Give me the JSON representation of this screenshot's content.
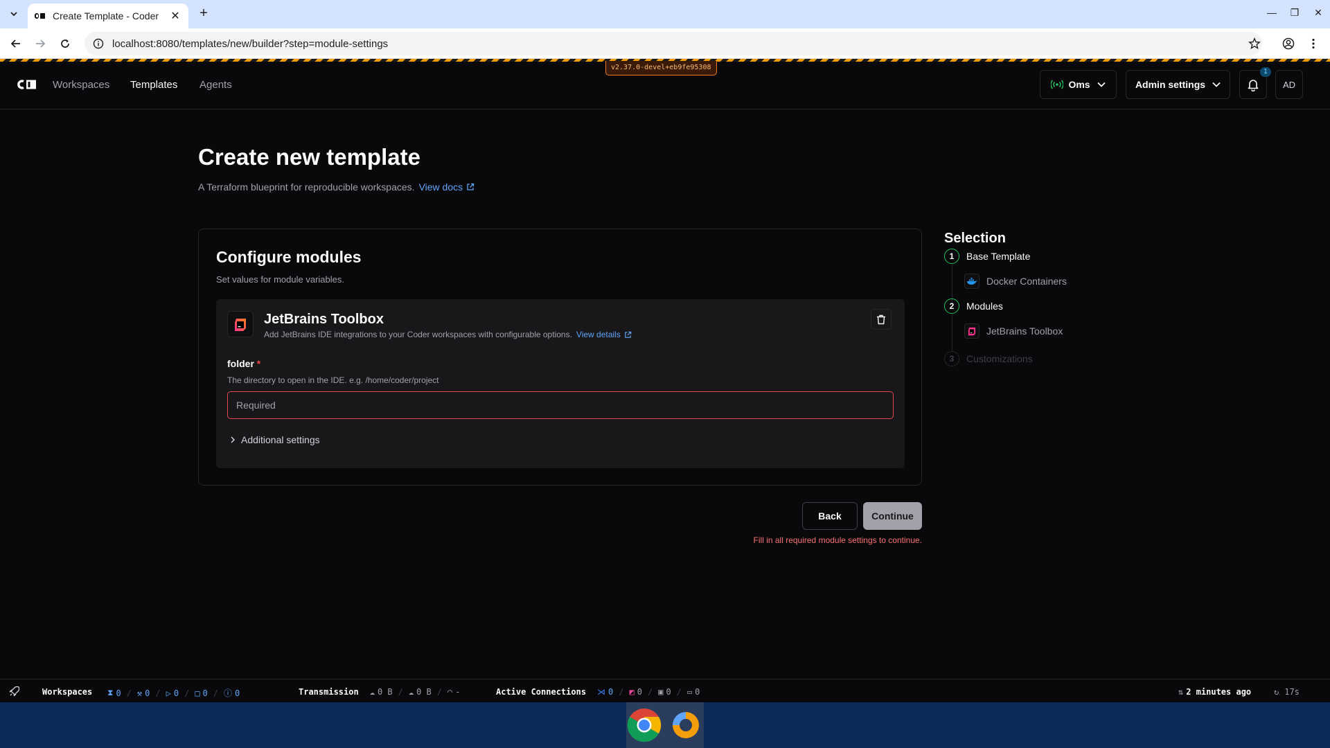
{
  "browser": {
    "tab_title": "Create Template - Coder",
    "url": "localhost:8080/templates/new/builder?step=module-settings"
  },
  "version_badge": "v2.37.0-devel+eb9fe95308",
  "nav": {
    "workspaces": "Workspaces",
    "templates": "Templates",
    "agents": "Agents",
    "region": "Oms",
    "admin_settings": "Admin settings",
    "notification_count": "1",
    "avatar": "AD"
  },
  "page": {
    "title": "Create new template",
    "subtitle": "A Terraform blueprint for reproducible workspaces.",
    "docs_link": "View docs"
  },
  "card": {
    "title": "Configure modules",
    "subtitle": "Set values for module variables.",
    "module": {
      "name": "JetBrains Toolbox",
      "description": "Add JetBrains IDE integrations to your Coder workspaces with configurable options.",
      "details_link": "View details",
      "field_label": "folder",
      "field_required_mark": "*",
      "field_help": "The directory to open in the IDE. e.g. /home/coder/project",
      "field_placeholder": "Required",
      "field_value": "",
      "additional_settings": "Additional settings"
    }
  },
  "actions": {
    "back": "Back",
    "continue": "Continue",
    "error": "Fill in all required module settings to continue."
  },
  "selection": {
    "title": "Selection",
    "steps": [
      {
        "num": "1",
        "label": "Base Template",
        "item": "Docker Containers",
        "state": "done"
      },
      {
        "num": "2",
        "label": "Modules",
        "item": "JetBrains Toolbox",
        "state": "done"
      },
      {
        "num": "3",
        "label": "Customizations",
        "state": "pending"
      }
    ]
  },
  "statusbar": {
    "workspaces_label": "Workspaces",
    "pending": "0",
    "building": "0",
    "running": "0",
    "stopped": "0",
    "failed": "0",
    "transmission_label": "Transmission",
    "tx_down": "0 B",
    "tx_up": "0 B",
    "latency": "-",
    "connections_label": "Active Connections",
    "vscode": "0",
    "jetbrains": "0",
    "terminal": "0",
    "ssh": "0",
    "updated": "2 minutes ago",
    "refresh": "17s"
  },
  "colors": {
    "accent_link": "#60a5fa",
    "error": "#f87171",
    "step_done": "#22c55e",
    "version_border": "#ea7a2b"
  }
}
